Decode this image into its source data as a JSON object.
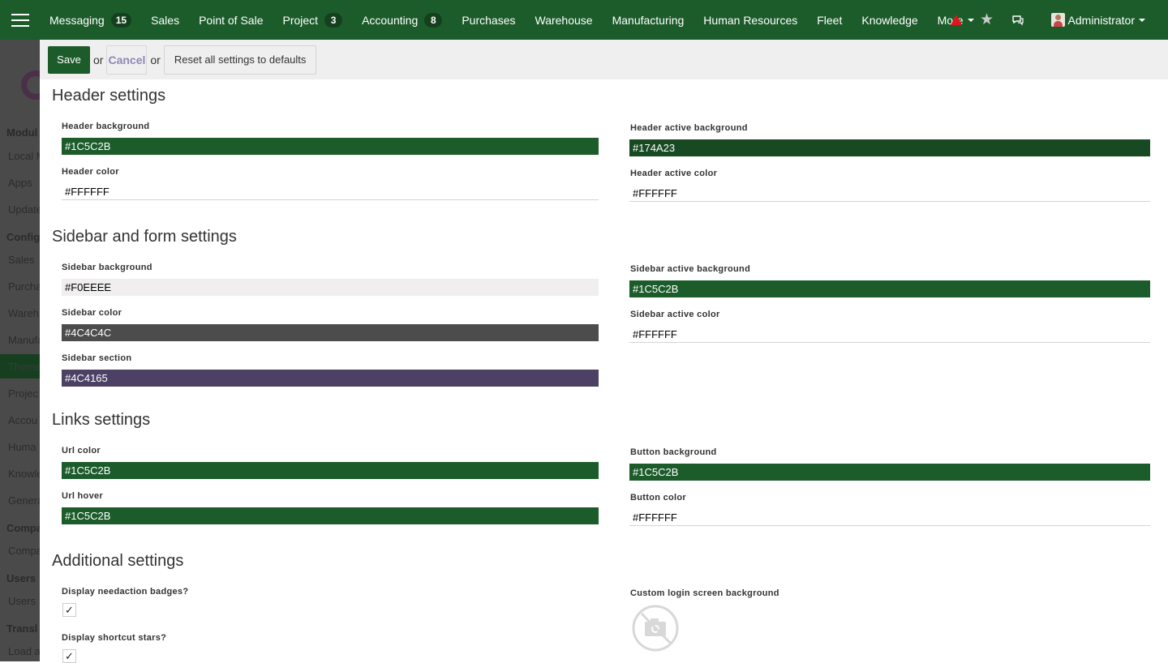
{
  "navbar": {
    "background": "#1C5C2B",
    "menu": [
      {
        "label": "Messaging",
        "badge": "15"
      },
      {
        "label": "Sales",
        "badge": ""
      },
      {
        "label": "Point of Sale",
        "badge": ""
      },
      {
        "label": "Project",
        "badge": "3"
      },
      {
        "label": "Accounting",
        "badge": "8"
      },
      {
        "label": "Purchases",
        "badge": ""
      },
      {
        "label": "Warehouse",
        "badge": ""
      },
      {
        "label": "Manufacturing",
        "badge": ""
      },
      {
        "label": "Human Resources",
        "badge": ""
      },
      {
        "label": "Fleet",
        "badge": ""
      },
      {
        "label": "Knowledge",
        "badge": ""
      }
    ],
    "more_label": "More",
    "user_name": "Administrator",
    "icons": [
      "menu-icon",
      "warning-icon",
      "star-icon",
      "chat-icon",
      "avatar"
    ]
  },
  "sidebar": {
    "sections": [
      "Modul",
      "Config",
      "Compa",
      "Users",
      "Transl"
    ],
    "items": [
      "Local M",
      "Apps",
      "Update",
      "Sales",
      "Purcha",
      "Wareh",
      "Manufa",
      "Theme",
      "Projec",
      "Accou",
      "Huma",
      "Knowle",
      "Genera",
      "Compa",
      "Users",
      "Load a"
    ]
  },
  "control_panel": {
    "save_label": "Save",
    "or_1": "or",
    "cancel_label": "Cancel",
    "or_2": "or",
    "reset_label": "Reset all settings to defaults"
  },
  "sections": {
    "header": {
      "title": "Header settings",
      "fields": {
        "header_background": {
          "label": "Header background",
          "value": "#1C5C2B"
        },
        "header_color": {
          "label": "Header color",
          "value": "#FFFFFF"
        },
        "header_active_background": {
          "label": "Header active background",
          "value": "#174A23"
        },
        "header_active_color": {
          "label": "Header active color",
          "value": "#FFFFFF"
        }
      }
    },
    "sidebar_form": {
      "title": "Sidebar and form settings",
      "fields": {
        "sidebar_background": {
          "label": "Sidebar background",
          "value": "#F0EEEE"
        },
        "sidebar_color": {
          "label": "Sidebar color",
          "value": "#4C4C4C"
        },
        "sidebar_section": {
          "label": "Sidebar section",
          "value": "#4C4165"
        },
        "sidebar_active_background": {
          "label": "Sidebar active background",
          "value": "#1C5C2B"
        },
        "sidebar_active_color": {
          "label": "Sidebar active color",
          "value": "#FFFFFF"
        }
      }
    },
    "links": {
      "title": "Links settings",
      "fields": {
        "url_color": {
          "label": "Url color",
          "value": "#1C5C2B"
        },
        "url_hover": {
          "label": "Url hover",
          "value": "#1C5C2B"
        },
        "button_background": {
          "label": "Button background",
          "value": "#1C5C2B"
        },
        "button_color": {
          "label": "Button color",
          "value": "#FFFFFF"
        }
      }
    },
    "additional": {
      "title": "Additional settings",
      "fields": {
        "needaction_badges": {
          "label": "Display needaction badges?",
          "value": "✓"
        },
        "shortcut_stars": {
          "label": "Display shortcut stars?",
          "value": "✓"
        },
        "login_background": {
          "label": "Custom login screen background",
          "icon": "no-image-icon"
        }
      }
    }
  }
}
